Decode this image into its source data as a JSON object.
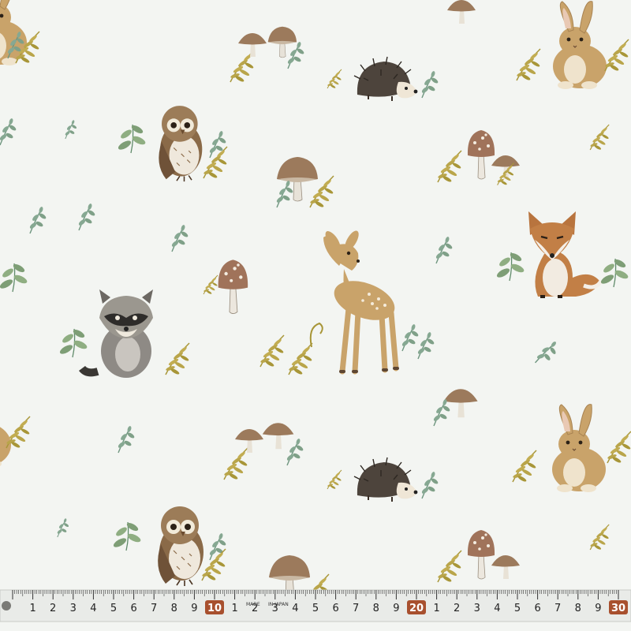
{
  "image": {
    "subject": "woodland-animal-fabric-print",
    "palette": {
      "background": "#f3f5f2",
      "fawn": "#c9a36a",
      "brown": "#8a6a48",
      "rust": "#b8743e",
      "grey": "#8e8a85",
      "leaf_green": "#7fa088",
      "leaf_olive": "#b4a040",
      "mushroom_cap": "#9c7a5c",
      "ruler_tape": "#e9ebe8",
      "ruler_marker": "#a8502e"
    },
    "motifs": [
      "deer",
      "fox",
      "owl",
      "raccoon",
      "hedgehog",
      "rabbit",
      "mushroom",
      "fern",
      "leaf-sprig"
    ]
  },
  "ruler": {
    "numbers": [
      "1",
      "2",
      "3",
      "4",
      "5",
      "6",
      "7",
      "8",
      "9",
      "10",
      "1",
      "2",
      "3",
      "4",
      "5",
      "6",
      "7",
      "8",
      "9",
      "20",
      "1",
      "2",
      "3",
      "4",
      "5",
      "6",
      "7",
      "8",
      "9",
      "30"
    ],
    "highlighted": [
      "10",
      "20",
      "30"
    ],
    "imprints": [
      "MADE",
      "IN JAPAN"
    ]
  }
}
